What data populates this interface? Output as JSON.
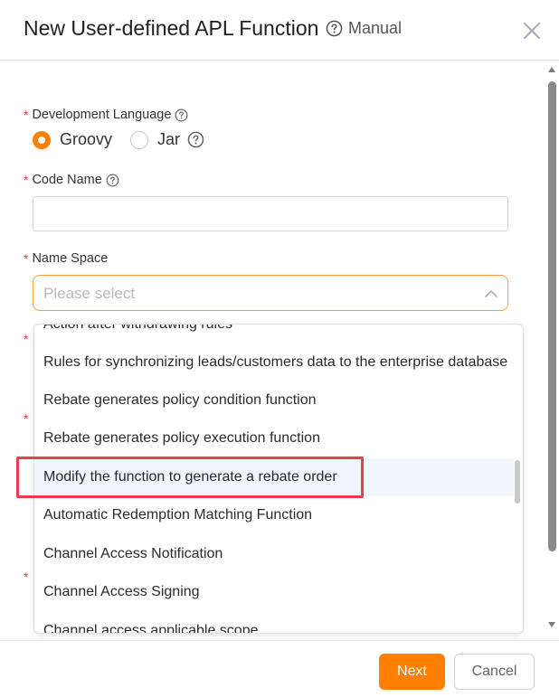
{
  "header": {
    "title": "New User-defined APL Function",
    "manual_label": "Manual"
  },
  "form": {
    "dev_language": {
      "required_mark": "*",
      "label": "Development Language",
      "options": [
        {
          "label": "Groovy",
          "checked": true
        },
        {
          "label": "Jar",
          "checked": false
        }
      ]
    },
    "code_name": {
      "required_mark": "*",
      "label": "Code Name",
      "value": ""
    },
    "name_space": {
      "required_mark": "*",
      "label": "Name Space",
      "placeholder": "Please select"
    },
    "hidden_required_marks": [
      "*",
      "*",
      "*"
    ]
  },
  "dropdown": {
    "items": [
      "Action after withdrawing rules",
      "Rules for synchronizing leads/customers data to the enterprise database",
      "Rebate generates policy condition function",
      "Rebate generates policy execution function",
      "Modify the function to generate a rebate order",
      "Automatic Redemption Matching Function",
      "Channel Access Notification",
      "Channel Access Signing",
      "Channel access applicable scope"
    ],
    "selected_index": 4
  },
  "footer": {
    "next_label": "Next",
    "cancel_label": "Cancel"
  },
  "colors": {
    "accent": "#ff8000",
    "required": "#e5393a",
    "highlight": "#e8404b"
  },
  "icons": {
    "help": "question-circle-icon",
    "close": "close-icon",
    "chevron": "chevron-up-icon"
  }
}
